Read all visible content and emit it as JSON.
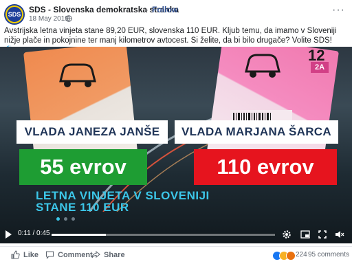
{
  "post": {
    "avatar_text": "SDS",
    "page_name": "SDS - Slovenska demokratska stranka",
    "separator": "·",
    "follow_label": "Follow",
    "date": "18 May 2019 ·",
    "more_label": "···",
    "text": "Avstrijska letna vinjeta stane 89,20 EUR, slovenska 110 EUR. Kljub temu, da imamo v Sloveniji nižje plače in pokojnine ter manj kilometrov avtocest. Si želite, da bi bilo drugače? Volite SDS! 🗳️..."
  },
  "video": {
    "sticker_number": "12",
    "sticker_badge": "2A",
    "left_banner": "VLADA JANEZA JANŠE",
    "right_banner": "VLADA MARJANA ŠARCA",
    "left_price": "55 evrov",
    "right_price": "110 evrov",
    "caption_line1": "LETNA VINJETA V SLOVENIJI",
    "caption_line2": "STANE 110 EUR",
    "time_display": "0:11 / 0:45",
    "progress": 0.244,
    "colors": {
      "left_price_bg": "#1e9d33",
      "right_price_bg": "#e6141e",
      "caption": "#3cc6e8",
      "banner_text": "#1f3457"
    }
  },
  "controls": {
    "icons": [
      "play-icon",
      "settings-icon",
      "picture-in-picture-icon",
      "fullscreen-icon",
      "mute-icon"
    ]
  },
  "footer": {
    "like_label": "Like",
    "comment_label": "Comment",
    "share_label": "Share",
    "reaction_count": "224",
    "comment_count": "95 comments"
  }
}
